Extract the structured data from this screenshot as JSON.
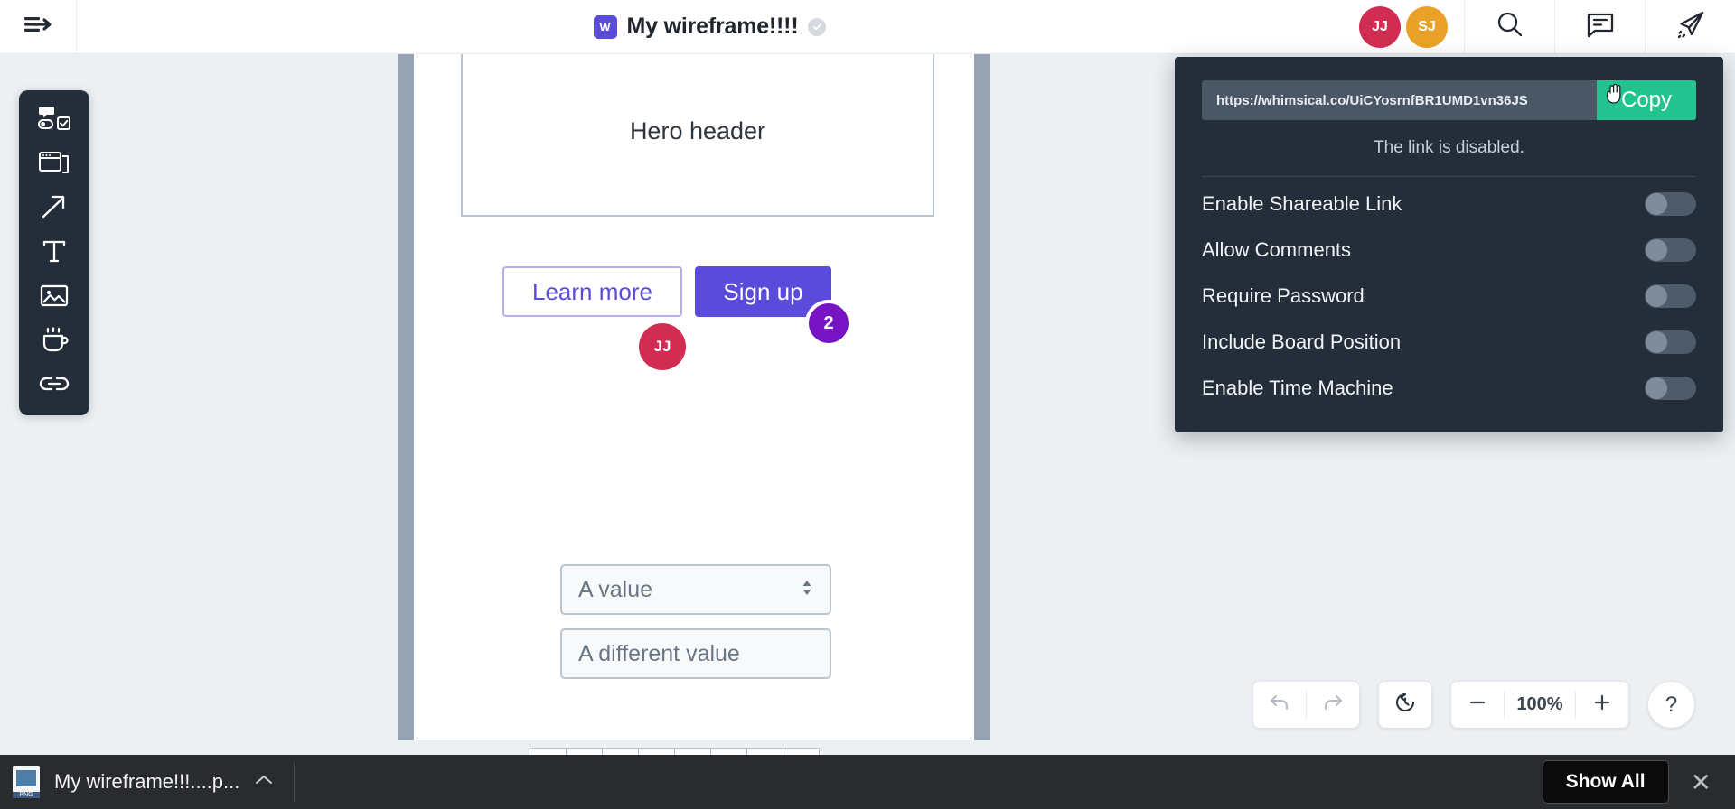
{
  "topbar": {
    "menu_icon": "menu-arrow-icon",
    "doc_badge": "W",
    "title": "My wireframe!!!!",
    "saved_icon": "check-circle-icon",
    "avatars": [
      {
        "initials": "JJ",
        "color": "#d12d53"
      },
      {
        "initials": "SJ",
        "color": "#e9a227"
      }
    ],
    "icons": [
      {
        "name": "search-icon"
      },
      {
        "name": "comment-icon"
      },
      {
        "name": "share-send-icon"
      }
    ]
  },
  "toolbar": {
    "items": [
      {
        "name": "ui-components-icon",
        "label": "UI components"
      },
      {
        "name": "window-frame-icon",
        "label": "Window"
      },
      {
        "name": "arrow-connector-icon",
        "label": "Arrow"
      },
      {
        "name": "text-icon",
        "label": "Text"
      },
      {
        "name": "image-icon",
        "label": "Image"
      },
      {
        "name": "cup-icon",
        "label": "Cup"
      },
      {
        "name": "link-icon",
        "label": "Link"
      }
    ]
  },
  "canvas": {
    "hero_text": "Hero header",
    "learn_more_label": "Learn more",
    "sign_up_label": "Sign up",
    "cursor_badge": "JJ",
    "count_badge": "2",
    "select_value": "A value",
    "input_value": "A different value",
    "grid_columns": 8
  },
  "share_panel": {
    "url": "https://whimsical.co/UiCYosrnfBR1UMD1vn36JS",
    "copy_label": "Copy",
    "copy_color": "#22c38f",
    "link_status": "The link is disabled.",
    "options": [
      {
        "label": "Enable Shareable Link",
        "enabled": false
      },
      {
        "label": "Allow Comments",
        "enabled": false
      },
      {
        "label": "Require Password",
        "enabled": false
      },
      {
        "label": "Include Board Position",
        "enabled": false
      },
      {
        "label": "Enable Time Machine",
        "enabled": false
      }
    ]
  },
  "bottom_controls": {
    "undo": "undo-icon",
    "redo": "redo-icon",
    "history": "history-icon",
    "zoom_out": "minus-icon",
    "zoom_level": "100%",
    "zoom_in": "plus-icon",
    "help": "?"
  },
  "download_bar": {
    "file_name": "My wireframe!!!....p...",
    "file_type": "PNG",
    "expand_icon": "chevron-up-icon",
    "show_all_label": "Show All",
    "close_icon": "close-icon"
  }
}
